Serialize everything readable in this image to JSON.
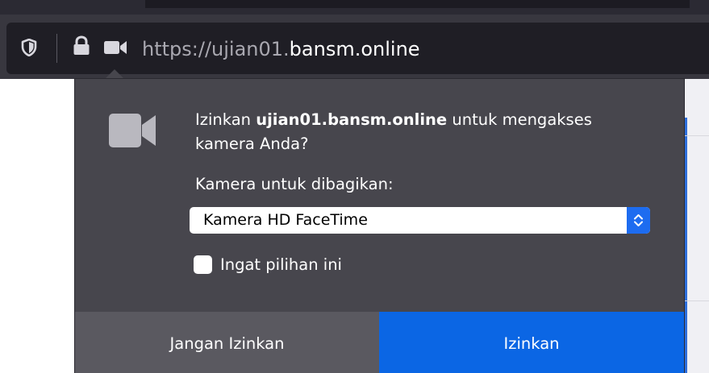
{
  "urlbar": {
    "url_prefix": "https://ujian01.",
    "url_domain": "bansm.online"
  },
  "icons": {
    "tracking_protection": "shield-icon",
    "connection": "lock-icon",
    "camera_permission": "camera-icon",
    "prompt_icon": "camera-icon"
  },
  "popup": {
    "prompt_prefix": "Izinkan ",
    "prompt_host": "ujian01.bansm.online",
    "prompt_suffix": " untuk mengakses kamera Anda?",
    "select_label": "Kamera untuk dibagikan:",
    "selected_camera": "Kamera HD FaceTime",
    "remember_label": "Ingat pilihan ini",
    "remember_checked": false,
    "deny_button": "Jangan Izinkan",
    "allow_button": "Izinkan"
  },
  "colors": {
    "panel_bg": "#47464d",
    "allow_button_bg": "#0b66e4",
    "deny_button_bg": "#5a5960",
    "stepper_blue": "#1d6cf0"
  }
}
